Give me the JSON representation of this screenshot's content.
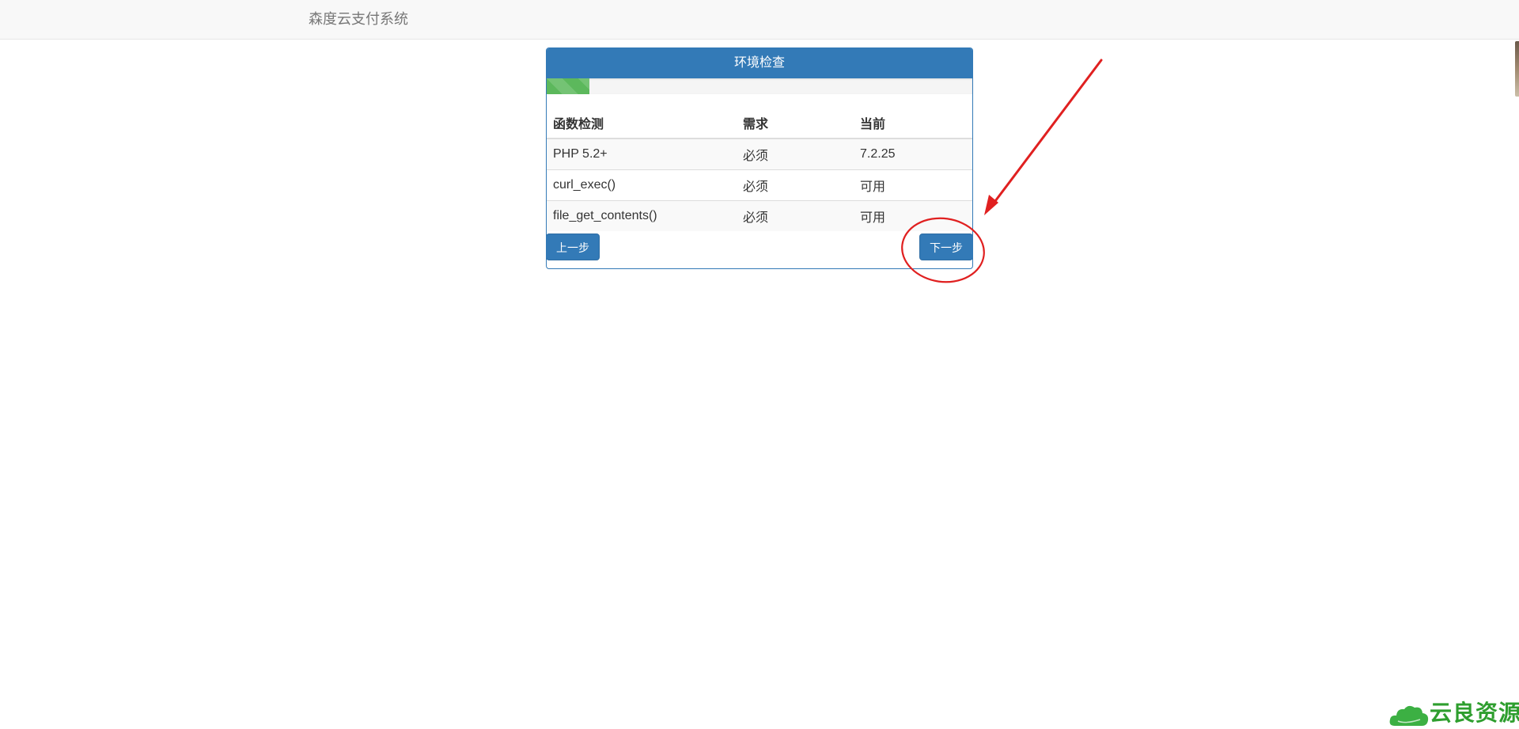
{
  "app": {
    "brand": "森度云支付系统"
  },
  "panel": {
    "title": "环境检查",
    "progress_fraction": 0.1,
    "table": {
      "headers": [
        "函数检测",
        "需求",
        "当前"
      ],
      "rows": [
        {
          "name": "PHP 5.2+",
          "requirement": "必须",
          "current": "7.2.25",
          "status": "version"
        },
        {
          "name": "curl_exec()",
          "requirement": "必须",
          "current": "可用",
          "status": "ok"
        },
        {
          "name": "file_get_contents()",
          "requirement": "必须",
          "current": "可用",
          "status": "ok"
        }
      ]
    },
    "buttons": {
      "prev": "上一步",
      "next": "下一步"
    }
  },
  "colors": {
    "primary": "#337ab7",
    "success": "#5cb85c",
    "ok_text": "#008000",
    "annotation": "#e02020"
  },
  "watermark": {
    "text": "云良资源网"
  }
}
